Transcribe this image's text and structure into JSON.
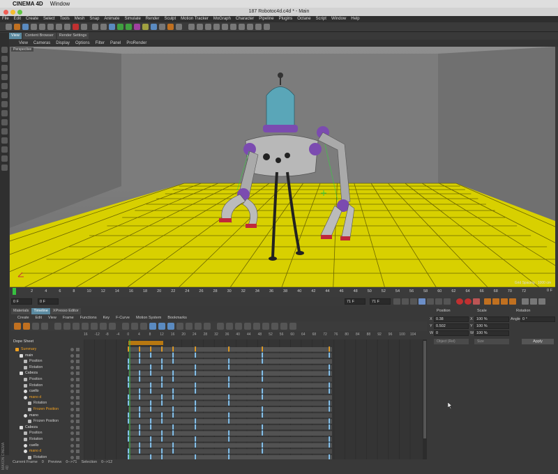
{
  "mac": {
    "apple_glyph": "",
    "app": "CINEMA 4D",
    "menu": "Window"
  },
  "window": {
    "title": "187 Robotoc4d.c4d * - Main"
  },
  "menubar": [
    "File",
    "Edit",
    "Create",
    "Select",
    "Tools",
    "Mesh",
    "Snap",
    "Animate",
    "Simulate",
    "Render",
    "Sculpt",
    "Motion Tracker",
    "MoGraph",
    "Character",
    "Pipeline",
    "Plugins",
    "Octane",
    "Script",
    "Window",
    "Help"
  ],
  "view_tabs": [
    {
      "label": "View",
      "active": true
    },
    {
      "label": "Content Browser",
      "active": false
    },
    {
      "label": "Render Settings",
      "active": false
    }
  ],
  "viewport_menu": [
    "View",
    "Cameras",
    "Display",
    "Options",
    "Filter",
    "Panel",
    "ProRender"
  ],
  "viewport": {
    "label": "Perspective",
    "grid_spacing": "Grid Spacing : 1000 cm"
  },
  "ruler": {
    "ticks": [
      "2",
      "4",
      "6",
      "8",
      "10",
      "12",
      "14",
      "16",
      "18",
      "20",
      "22",
      "24",
      "26",
      "28",
      "30",
      "32",
      "34",
      "36",
      "38",
      "40",
      "42",
      "44",
      "46",
      "48",
      "50",
      "52",
      "54",
      "56",
      "58",
      "60",
      "62",
      "64",
      "66",
      "68",
      "70",
      "72"
    ],
    "start_mark": "0 F"
  },
  "transport": {
    "current": "0 F",
    "start": "0 F",
    "end": "71 F",
    "end2": "71 F"
  },
  "timeline_tabs": [
    {
      "label": "Materials",
      "active": false
    },
    {
      "label": "Timeline",
      "active": true
    },
    {
      "label": "XPresso Editor",
      "active": false
    }
  ],
  "timeline_menu": [
    "Create",
    "Edit",
    "View",
    "Frame",
    "Functions",
    "Key",
    "F-Curve",
    "Motion System",
    "Bookmarks"
  ],
  "timeline_header": [
    "16",
    "-12",
    "-8",
    "-4",
    "0",
    "4",
    "8",
    "12",
    "16",
    "20",
    "24",
    "28",
    "32",
    "36",
    "40",
    "44",
    "48",
    "52",
    "56",
    "60",
    "64",
    "68",
    "72",
    "76",
    "80",
    "84",
    "88",
    "92",
    "96",
    "100",
    "104"
  ],
  "dope_sheet_label": "Dope Sheet",
  "tree": [
    {
      "label": "Summary",
      "indent": 0,
      "icon": "summary",
      "color": "#f0a020"
    },
    {
      "label": "main",
      "indent": 1,
      "icon": "null",
      "color": "#dddddd"
    },
    {
      "label": "Position",
      "indent": 2,
      "icon": "folder",
      "color": "#cccccc"
    },
    {
      "label": "Rotation",
      "indent": 2,
      "icon": "folder",
      "color": "#cccccc"
    },
    {
      "label": "Cabeza",
      "indent": 1,
      "icon": "null",
      "color": "#dddddd"
    },
    {
      "label": "Position",
      "indent": 2,
      "icon": "folder",
      "color": "#cccccc"
    },
    {
      "label": "Rotation",
      "indent": 2,
      "icon": "folder",
      "color": "#cccccc"
    },
    {
      "label": "cuello",
      "indent": 2,
      "icon": "joint",
      "color": "#dddddd"
    },
    {
      "label": "mano d",
      "indent": 2,
      "icon": "joint",
      "color": "#f0a020"
    },
    {
      "label": "Rotation",
      "indent": 3,
      "icon": "folder",
      "color": "#cccccc"
    },
    {
      "label": "Frozen Position",
      "indent": 3,
      "icon": "folder",
      "color": "#f0a020"
    },
    {
      "label": "mano",
      "indent": 2,
      "icon": "joint",
      "color": "#dddddd"
    },
    {
      "label": "Frozen Position",
      "indent": 3,
      "icon": "folder",
      "color": "#cccccc"
    },
    {
      "label": "Cabeza",
      "indent": 1,
      "icon": "null",
      "color": "#dddddd"
    },
    {
      "label": "Position",
      "indent": 2,
      "icon": "folder",
      "color": "#cccccc"
    },
    {
      "label": "Rotation",
      "indent": 2,
      "icon": "folder",
      "color": "#cccccc"
    },
    {
      "label": "cuello",
      "indent": 2,
      "icon": "joint",
      "color": "#dddddd"
    },
    {
      "label": "mano d",
      "indent": 2,
      "icon": "joint",
      "color": "#f0a020"
    },
    {
      "label": "Rotation",
      "indent": 3,
      "icon": "folder",
      "color": "#cccccc"
    }
  ],
  "status": {
    "current_frame_label": "Current Frame",
    "current_frame": "0",
    "preview_label": "Preview",
    "preview": "0-->71",
    "selection_label": "Selection",
    "selection": "0-->12"
  },
  "attributes": {
    "headers": [
      "Position",
      "Scale",
      "Rotation"
    ],
    "rows": [
      {
        "axis": "X",
        "pos": "0.38",
        "s_axis": "X",
        "scale": "100 %",
        "r_axis": "Angle",
        "rot": "0 °"
      },
      {
        "axis": "Y",
        "pos": "0.502",
        "s_axis": "Y",
        "scale": "100 %",
        "r_axis": "",
        "rot": ""
      },
      {
        "axis": "W",
        "pos": "0",
        "s_axis": "W",
        "scale": "100 %",
        "r_axis": "",
        "rot": ""
      }
    ],
    "coord_mode": "Object (Rel)",
    "size_mode": "Size",
    "apply": "Apply"
  },
  "side_logo": "MAXON CINEMA 4D",
  "colors": {
    "floor": "#d8d000",
    "accent": "#f0a020",
    "key": "#8ec8f0",
    "highlight": "#5b8aa0"
  }
}
